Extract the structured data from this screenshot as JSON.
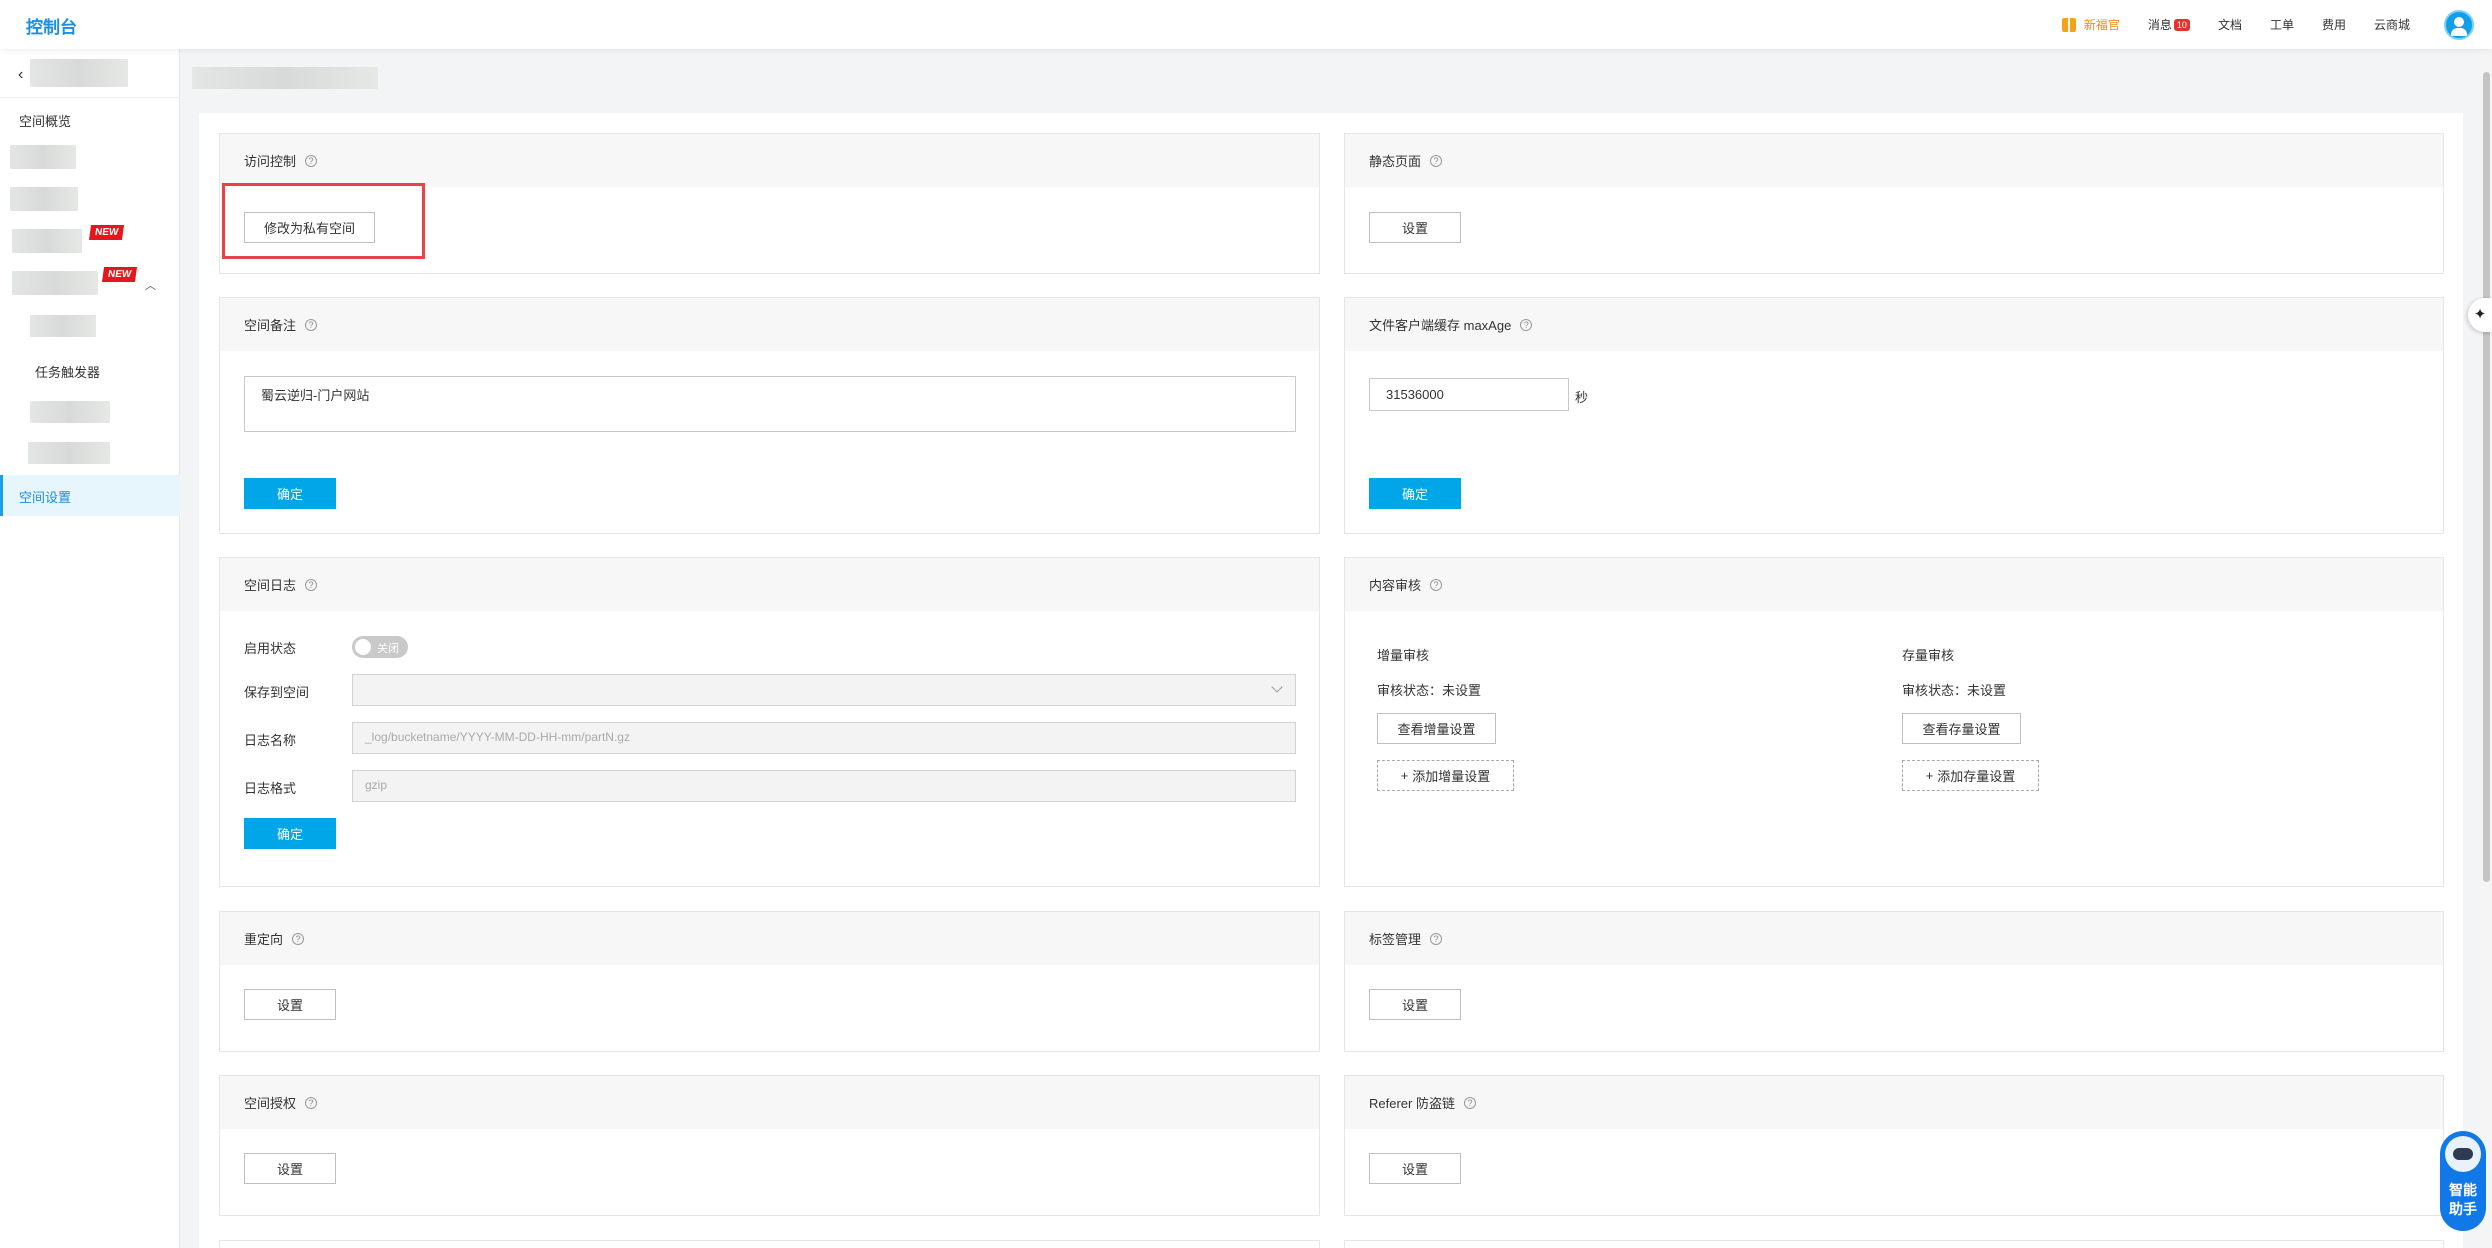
{
  "topbar": {
    "brand": "控制台",
    "nav": {
      "new_user": "新福官",
      "messages": "消息",
      "messages_badge": "10",
      "docs": "文档",
      "tickets": "工单",
      "billing": "费用",
      "marketplace": "云商城"
    }
  },
  "sidebar": {
    "overview": "空间概览",
    "new_tag": "NEW",
    "task_trigger": "任务触发器",
    "space_settings": "空间设置"
  },
  "cards": {
    "access": {
      "title": "访问控制",
      "button": "修改为私有空间"
    },
    "static": {
      "title": "静态页面",
      "button": "设置"
    },
    "remark": {
      "title": "空间备注",
      "value": "蜀云逆归-门户网站",
      "confirm": "确定"
    },
    "maxage": {
      "title": "文件客户端缓存 maxAge",
      "value": "31536000",
      "unit": "秒",
      "confirm": "确定"
    },
    "log": {
      "title": "空间日志",
      "status_label": "启用状态",
      "toggle_text": "关闭",
      "save_label": "保存到空间",
      "name_label": "日志名称",
      "name_placeholder": "_log/bucketname/YYYY-MM-DD-HH-mm/partN.gz",
      "format_label": "日志格式",
      "format_placeholder": "gzip",
      "confirm": "确定"
    },
    "audit": {
      "title": "内容审核",
      "incremental": {
        "heading": "增量审核",
        "status": "审核状态：未设置",
        "view_button": "查看增量设置",
        "add_button": "添加增量设置"
      },
      "stock": {
        "heading": "存量审核",
        "status": "审核状态：未设置",
        "view_button": "查看存量设置",
        "add_button": "添加存量设置"
      }
    },
    "redirect": {
      "title": "重定向",
      "button": "设置"
    },
    "tags": {
      "title": "标签管理",
      "button": "设置"
    },
    "auth": {
      "title": "空间授权",
      "button": "设置"
    },
    "referer": {
      "title": "Referer 防盗链",
      "button": "设置"
    }
  },
  "assistant": {
    "label": "智能助手"
  },
  "help_glyph": "?"
}
